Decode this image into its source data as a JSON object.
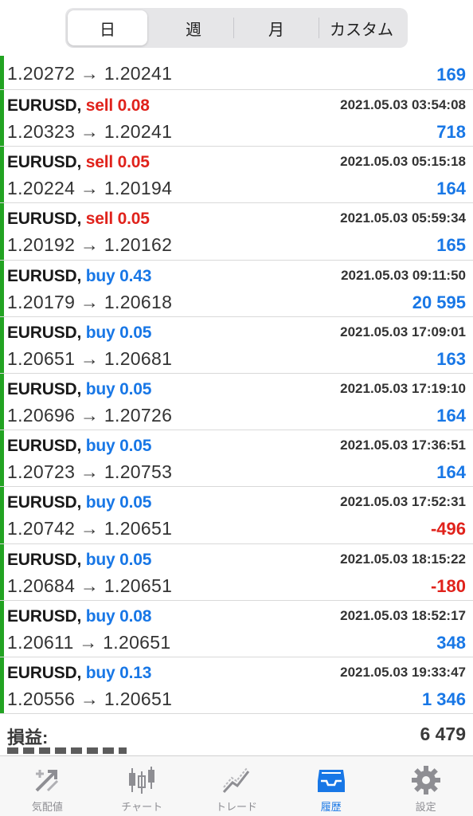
{
  "period_tabs": [
    {
      "label": "日",
      "active": true
    },
    {
      "label": "週",
      "active": false
    },
    {
      "label": "月",
      "active": false
    },
    {
      "label": "カスタム",
      "active": false
    }
  ],
  "partial_row": {
    "price": "1.20272 → 1.20241",
    "profit": "169"
  },
  "trades": [
    {
      "symbol": "EURUSD,",
      "side": "sell",
      "lot": "sell 0.08",
      "time": "2021.05.03 03:54:08",
      "price": "1.20323 → 1.20241",
      "profit": "718"
    },
    {
      "symbol": "EURUSD,",
      "side": "sell",
      "lot": "sell 0.05",
      "time": "2021.05.03 05:15:18",
      "price": "1.20224 → 1.20194",
      "profit": "164"
    },
    {
      "symbol": "EURUSD,",
      "side": "sell",
      "lot": "sell 0.05",
      "time": "2021.05.03 05:59:34",
      "price": "1.20192 → 1.20162",
      "profit": "165"
    },
    {
      "symbol": "EURUSD,",
      "side": "buy",
      "lot": "buy 0.43",
      "time": "2021.05.03 09:11:50",
      "price": "1.20179 → 1.20618",
      "profit": "20 595"
    },
    {
      "symbol": "EURUSD,",
      "side": "buy",
      "lot": "buy 0.05",
      "time": "2021.05.03 17:09:01",
      "price": "1.20651 → 1.20681",
      "profit": "163"
    },
    {
      "symbol": "EURUSD,",
      "side": "buy",
      "lot": "buy 0.05",
      "time": "2021.05.03 17:19:10",
      "price": "1.20696 → 1.20726",
      "profit": "164"
    },
    {
      "symbol": "EURUSD,",
      "side": "buy",
      "lot": "buy 0.05",
      "time": "2021.05.03 17:36:51",
      "price": "1.20723 → 1.20753",
      "profit": "164"
    },
    {
      "symbol": "EURUSD,",
      "side": "buy",
      "lot": "buy 0.05",
      "time": "2021.05.03 17:52:31",
      "price": "1.20742 → 1.20651",
      "profit": "-496"
    },
    {
      "symbol": "EURUSD,",
      "side": "buy",
      "lot": "buy 0.05",
      "time": "2021.05.03 18:15:22",
      "price": "1.20684 → 1.20651",
      "profit": "-180"
    },
    {
      "symbol": "EURUSD,",
      "side": "buy",
      "lot": "buy 0.08",
      "time": "2021.05.03 18:52:17",
      "price": "1.20611 → 1.20651",
      "profit": "348"
    },
    {
      "symbol": "EURUSD,",
      "side": "buy",
      "lot": "buy 0.13",
      "time": "2021.05.03 19:33:47",
      "price": "1.20556 → 1.20651",
      "profit": "1 346"
    }
  ],
  "summary": {
    "label": "損益:",
    "value": "6 479"
  },
  "bottom_tabs": [
    {
      "label": "気配値",
      "icon": "quotes-icon",
      "active": false
    },
    {
      "label": "チャート",
      "icon": "candlestick-chart-icon",
      "active": false
    },
    {
      "label": "トレード",
      "icon": "trade-chart-icon",
      "active": false
    },
    {
      "label": "履歴",
      "icon": "history-tray-icon",
      "active": true
    },
    {
      "label": "設定",
      "icon": "gear-icon",
      "active": false
    }
  ],
  "colors": {
    "sell": "#e0221b",
    "buy": "#1877e6",
    "loss": "#e0221b",
    "profit": "#1877e6",
    "trade_bar": "#22a322",
    "tab_active": "#1877e6",
    "tab_inactive": "#8e8e93"
  }
}
